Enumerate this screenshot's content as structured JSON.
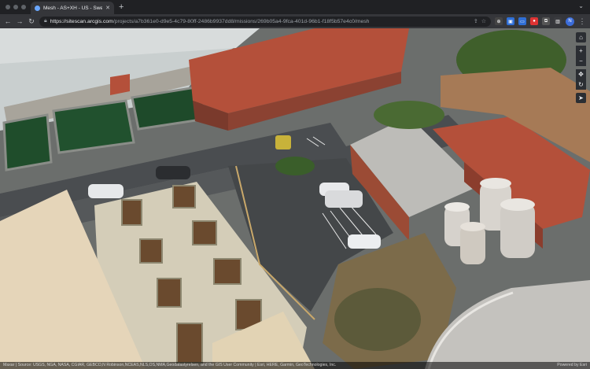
{
  "browser": {
    "tab_title": "Mesh - AS+XH - US - Sweetw",
    "url_host": "https://sitescan.arcgis.com",
    "url_path": "/projects/a7b361e0-d9e5-4c79-80ff-2486b9937dd8/missions/269b05a4-9fca-401d-96b1-f18f5b57e4c0/mesh",
    "avatar_letter": "N",
    "colors": {
      "frame": "#202124",
      "toolbar": "#35363a"
    }
  },
  "map": {
    "controls": [
      "home-icon",
      "zoom-in-icon",
      "zoom-out-icon",
      "pan-icon",
      "rotate-icon",
      "compass-icon"
    ],
    "attribution": "Maxar | Source: USGS, NGA, NASA, CGIAR, GEBCO,N Robinson,NCEAS,NLS,OS,NMA,Geodatastyrelsen, and the GIS User Community | Esri, HERE, Garmin, GeoTechnologies, Inc.",
    "powered_by": "Powered by Esri",
    "colors": {
      "roof_red": "#b4503a",
      "asphalt": "#4a4d50",
      "grass": "#5c7a3c",
      "tank": "#cfcac3"
    }
  }
}
